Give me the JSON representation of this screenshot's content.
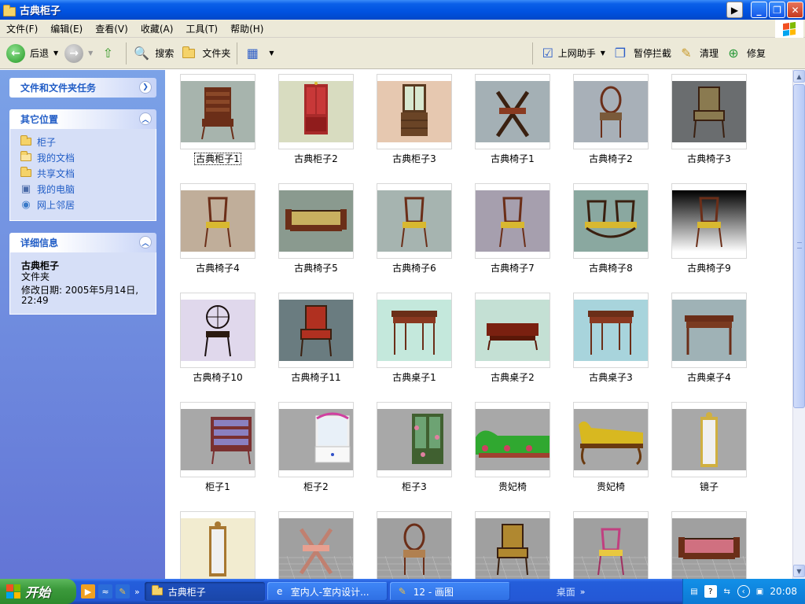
{
  "window": {
    "title": "古典柜子"
  },
  "menu": [
    {
      "label": "文件(F)"
    },
    {
      "label": "编辑(E)"
    },
    {
      "label": "查看(V)"
    },
    {
      "label": "收藏(A)"
    },
    {
      "label": "工具(T)"
    },
    {
      "label": "帮助(H)"
    }
  ],
  "toolbar": {
    "back": "后退",
    "search": "搜索",
    "folders": "文件夹",
    "assistant": "上网助手",
    "block_popups": "暂停拦截",
    "clean": "清理",
    "repair": "修复"
  },
  "sidebar": {
    "tasks_title": "文件和文件夹任务",
    "other_title": "其它位置",
    "other_links": [
      {
        "label": "柜子",
        "icon": "folder-icon"
      },
      {
        "label": "我的文档",
        "icon": "documents-icon"
      },
      {
        "label": "共享文档",
        "icon": "folder-icon"
      },
      {
        "label": "我的电脑",
        "icon": "computer-icon"
      },
      {
        "label": "网上邻居",
        "icon": "network-icon"
      }
    ],
    "details_title": "详细信息",
    "details_name": "古典柜子",
    "details_type": "文件夹",
    "details_modified_line1": "修改日期: 2005年5月14日,",
    "details_modified_line2": "22:49"
  },
  "files": [
    {
      "name": "古典柜子1",
      "bg": "#a7b4ad",
      "kind": "highboy"
    },
    {
      "name": "古典柜子2",
      "bg": "#d8dcc0",
      "kind": "cabinet-red"
    },
    {
      "name": "古典柜子3",
      "bg": "#e6c8b0",
      "kind": "secretary"
    },
    {
      "name": "古典椅子1",
      "bg": "#a4b0b5",
      "kind": "x-chair"
    },
    {
      "name": "古典椅子2",
      "bg": "#a8b0b8",
      "kind": "shield-chair"
    },
    {
      "name": "古典椅子3",
      "bg": "#6a6d6f",
      "kind": "armchair"
    },
    {
      "name": "古典椅子4",
      "bg": "#c0ae9a",
      "kind": "side-chair"
    },
    {
      "name": "古典椅子5",
      "bg": "#8a9a8f",
      "kind": "sofa"
    },
    {
      "name": "古典椅子6",
      "bg": "#a6b4b0",
      "kind": "side-chair"
    },
    {
      "name": "古典椅子7",
      "bg": "#a69fae",
      "kind": "side-chair"
    },
    {
      "name": "古典椅子8",
      "bg": "#8aa8a0",
      "kind": "double-chair"
    },
    {
      "name": "古典椅子9",
      "bg": "#3a3a3a",
      "kind": "side-chair"
    },
    {
      "name": "古典椅子10",
      "bg": "#e0d8ec",
      "kind": "wheel-chair"
    },
    {
      "name": "古典椅子11",
      "bg": "#6a7c80",
      "kind": "armchair-red"
    },
    {
      "name": "古典桌子1",
      "bg": "#c4e8dc",
      "kind": "table"
    },
    {
      "name": "古典桌子2",
      "bg": "#c4e0d4",
      "kind": "low-table"
    },
    {
      "name": "古典桌子3",
      "bg": "#a8d4dc",
      "kind": "table"
    },
    {
      "name": "古典桌子4",
      "bg": "#9fb2b6",
      "kind": "desk"
    },
    {
      "name": "柜子1",
      "bg": "#a8a8a8",
      "kind": "dresser"
    },
    {
      "name": "柜子2",
      "bg": "#a8a8a8",
      "kind": "vanity"
    },
    {
      "name": "柜子3",
      "bg": "#a8a8a8",
      "kind": "glass-cabinet"
    },
    {
      "name": "贵妃椅",
      "bg": "#a8a8a8",
      "kind": "chaise-green"
    },
    {
      "name": "贵妃椅",
      "bg": "#a8a8a8",
      "kind": "chaise-yellow"
    },
    {
      "name": "镜子",
      "bg": "#a8a8a8",
      "kind": "mirror"
    },
    {
      "name": "",
      "bg": "#f2ecd0",
      "kind": "mirror2"
    },
    {
      "name": "",
      "bg": "#a0a0a0",
      "kind": "x-chair-grid"
    },
    {
      "name": "",
      "bg": "#a0a0a0",
      "kind": "shield-grid"
    },
    {
      "name": "",
      "bg": "#a0a0a0",
      "kind": "armchair-gold"
    },
    {
      "name": "",
      "bg": "#a0a0a0",
      "kind": "chair-pink"
    },
    {
      "name": "",
      "bg": "#a0a0a0",
      "kind": "sofa-pink"
    }
  ],
  "taskbar": {
    "start": "开始",
    "tasks": [
      {
        "label": "古典柜子",
        "active": true
      },
      {
        "label": "室内人-室内设计...",
        "active": false
      },
      {
        "label": "12 - 画图",
        "active": false
      }
    ],
    "desktop": "桌面",
    "clock": "20:08"
  },
  "colors": {
    "title_blue": "#0052e0",
    "sidebar_link": "#215dc6",
    "taskbar_blue": "#245edb",
    "start_green": "#3c9a3c"
  }
}
